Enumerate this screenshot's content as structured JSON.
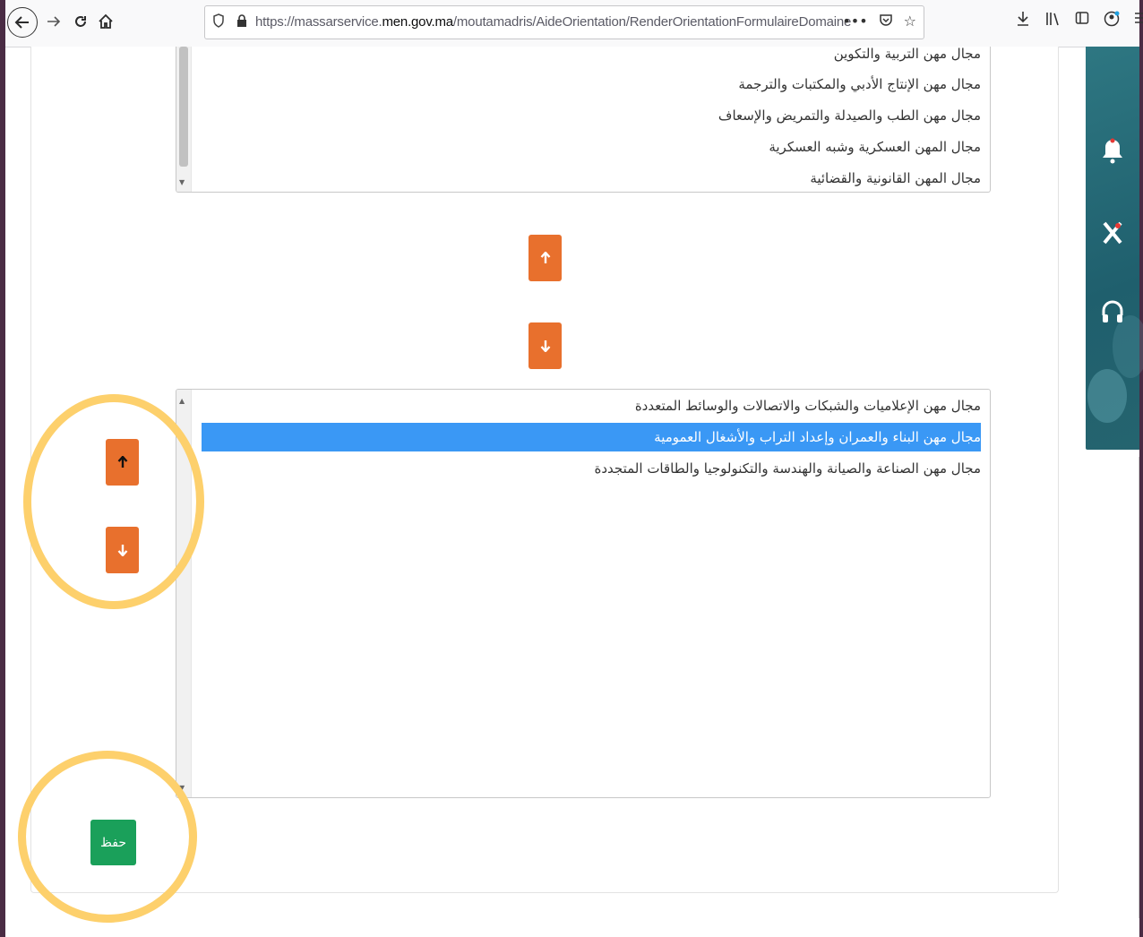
{
  "browser": {
    "url_prefix": "https://massarservice.",
    "url_domain": "men.gov.ma",
    "url_path": "/moutamadris/AideOrientation/RenderOrientationFormulaireDomaine",
    "icons": [
      "back-icon",
      "forward-icon",
      "reload-icon",
      "home-icon",
      "shield-icon",
      "lock-icon",
      "more-icon",
      "pocket-icon",
      "star-icon",
      "download-icon",
      "library-icon",
      "sidebar-icon",
      "profile-icon",
      "menu-icon"
    ]
  },
  "top_list": {
    "options": [
      "مجال مهن التربية والتكوين",
      "مجال مهن الإنتاج الأدبي والمكتبات والترجمة",
      "مجال مهن الطب والصيدلة والتمريض والإسعاف",
      "مجال المهن العسكرية وشبه العسكرية",
      "مجال المهن القانونية والقضائية"
    ]
  },
  "bottom_list": {
    "options": [
      "مجال مهن الإعلاميات والشبكات والاتصالات والوسائط المتعددة",
      "مجال مهن البناء والعمران وإعداد التراب والأشغال العمومية",
      "مجال مهن الصناعة والصيانة والهندسة والتكنولوجيا والطاقات المتجددة"
    ],
    "selected_index": 1
  },
  "buttons": {
    "move_up_glyph": "🡑",
    "move_down_glyph": "🡓",
    "save_label": "حفظ"
  },
  "colors": {
    "orange": "#e8702d",
    "green": "#1aa05a",
    "selection": "#3a98f5",
    "highlight_circle": "#fdd06c",
    "side_panel": "#2e7782"
  }
}
